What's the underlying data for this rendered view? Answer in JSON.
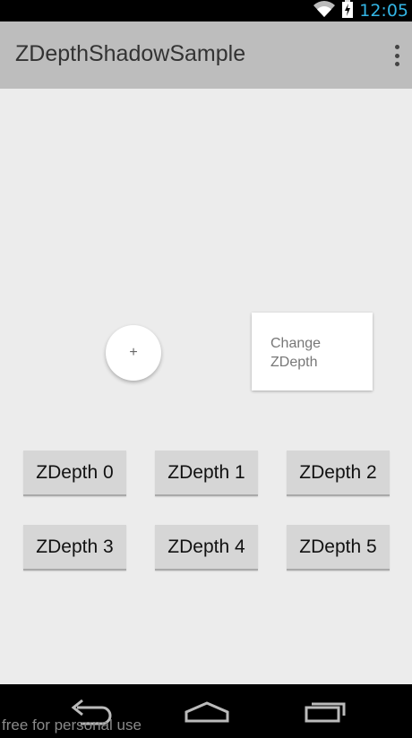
{
  "status_bar": {
    "time": "12:05",
    "icons": [
      "wifi-icon",
      "battery-charging-icon"
    ],
    "accent": "#33b5e5"
  },
  "action_bar": {
    "title": "ZDepthShadowSample",
    "menu_icon": "overflow-menu-icon"
  },
  "main": {
    "fab_label": "+",
    "change_button": {
      "line1": "Change",
      "line2": "ZDepth"
    },
    "zdepth_buttons": [
      "ZDepth 0",
      "ZDepth 1",
      "ZDepth 2",
      "ZDepth 3",
      "ZDepth 4",
      "ZDepth 5"
    ]
  },
  "nav_bar": {
    "icons": [
      "back-icon",
      "home-icon",
      "recent-apps-icon"
    ]
  },
  "watermark": "free for personal use"
}
